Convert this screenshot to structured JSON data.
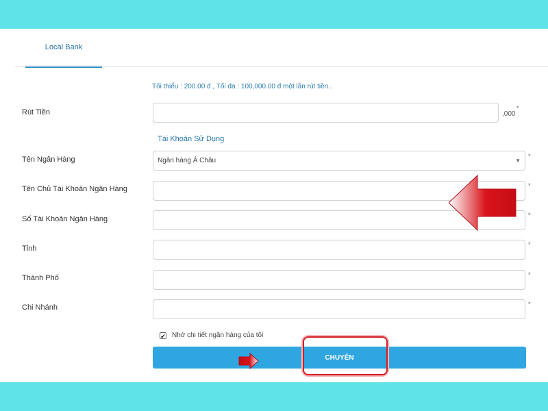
{
  "tabs": {
    "local_bank": "Local Bank"
  },
  "limits_text": "Tối thiểu : 200.00 đ , Tối đa : 100,000.00 đ một lần rút tiền..",
  "form": {
    "withdraw_label": "Rút Tiền",
    "withdraw_suffix": ",000",
    "account_section": "Tài Khoản Sử Dụng",
    "bank_name_label": "Tên Ngân Hàng",
    "bank_name_value": "Ngân hàng Á Châu",
    "account_holder_label": "Tên Chủ Tài Khoản Ngân Hàng",
    "account_number_label": "Số Tài Khoản Ngân Hàng",
    "province_label": "Tỉnh",
    "city_label": "Thành Phố",
    "branch_label": "Chi Nhánh",
    "required_mark": "*",
    "remember_label": "Nhớ chi tiết ngân hàng của tôi",
    "remember_checked": true,
    "check_mark": "✔",
    "submit_label": "CHUYỂN"
  },
  "colors": {
    "page_bg": "#5fe3e8",
    "accent": "#2fa6e0",
    "highlight": "#d41a22"
  }
}
